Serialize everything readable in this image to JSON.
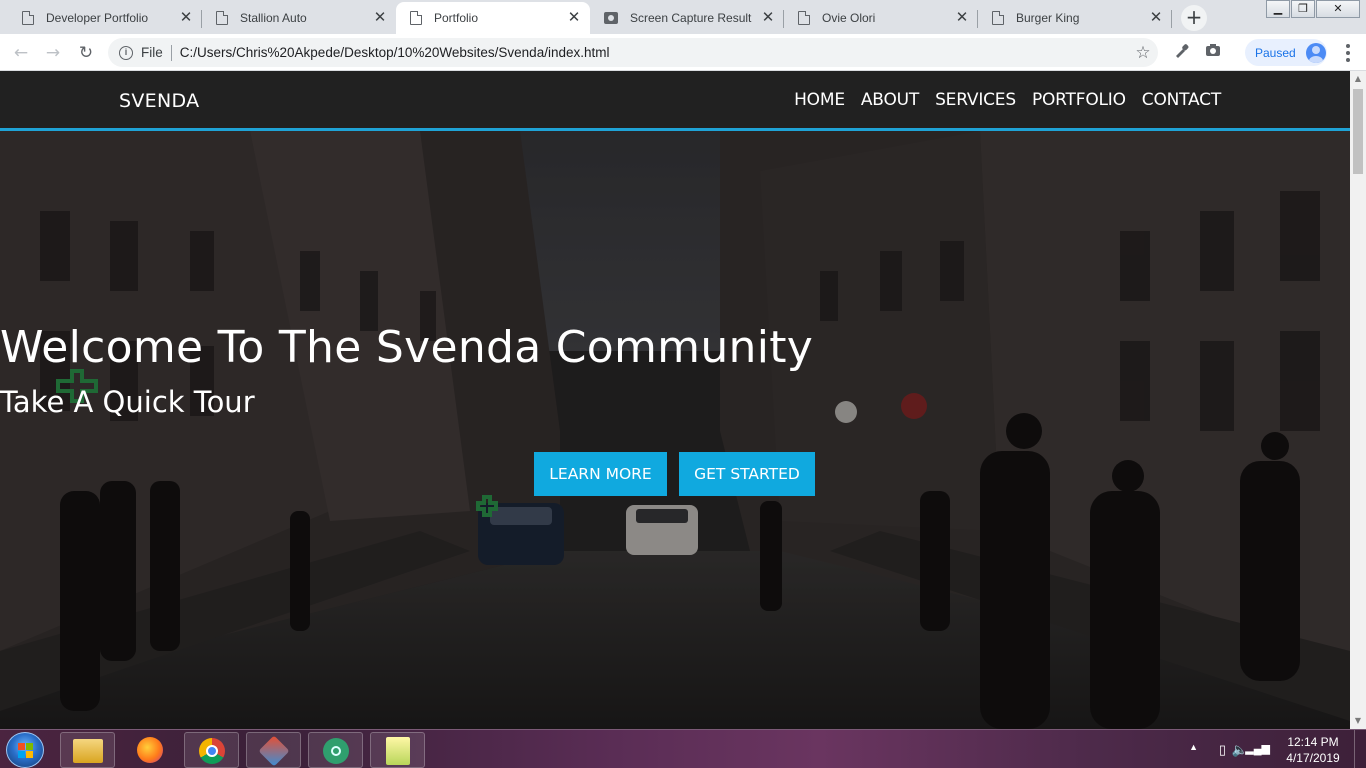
{
  "browser": {
    "tabs": [
      {
        "title": "Developer Portfolio",
        "icon": "page-icon",
        "active": false
      },
      {
        "title": "Stallion Auto",
        "icon": "page-icon",
        "active": false
      },
      {
        "title": "Portfolio",
        "icon": "page-icon",
        "active": true
      },
      {
        "title": "Screen Capture Result",
        "icon": "camera-icon",
        "active": false
      },
      {
        "title": "Ovie Olori",
        "icon": "page-icon",
        "active": false
      },
      {
        "title": "Burger King",
        "icon": "page-icon",
        "active": false
      }
    ],
    "close_glyph": "✕",
    "new_tab_glyph": "+",
    "window_controls": {
      "minimize": "▁",
      "maximize": "❐",
      "close": "✕"
    },
    "nav": {
      "back": "←",
      "forward": "→",
      "reload": "↻"
    },
    "omnibox": {
      "scheme_label": "File",
      "url": "C:/Users/Chris%20Akpede/Desktop/10%20Websites/Svenda/index.html",
      "bookmark_glyph": "☆"
    },
    "profile": {
      "status": "Paused"
    }
  },
  "site": {
    "brand": "SVENDA",
    "menu": [
      "HOME",
      "ABOUT",
      "SERVICES",
      "PORTFOLIO",
      "CONTACT"
    ],
    "hero": {
      "title": "Welcome To The Svenda Community",
      "subtitle": "Take A Quick Tour",
      "buttons": {
        "learn_more": "LEARN MORE",
        "get_started": "GET STARTED"
      }
    },
    "colors": {
      "nav_bg": "#212121",
      "accent": "#10a9df",
      "nav_border": "#1fa3d6"
    }
  },
  "taskbar": {
    "apps": [
      "file-explorer-icon",
      "firefox-icon",
      "chrome-icon",
      "git-icon",
      "atom-icon",
      "notepad-icon"
    ],
    "clock": {
      "time": "12:14 PM",
      "date": "4/17/2019"
    }
  }
}
